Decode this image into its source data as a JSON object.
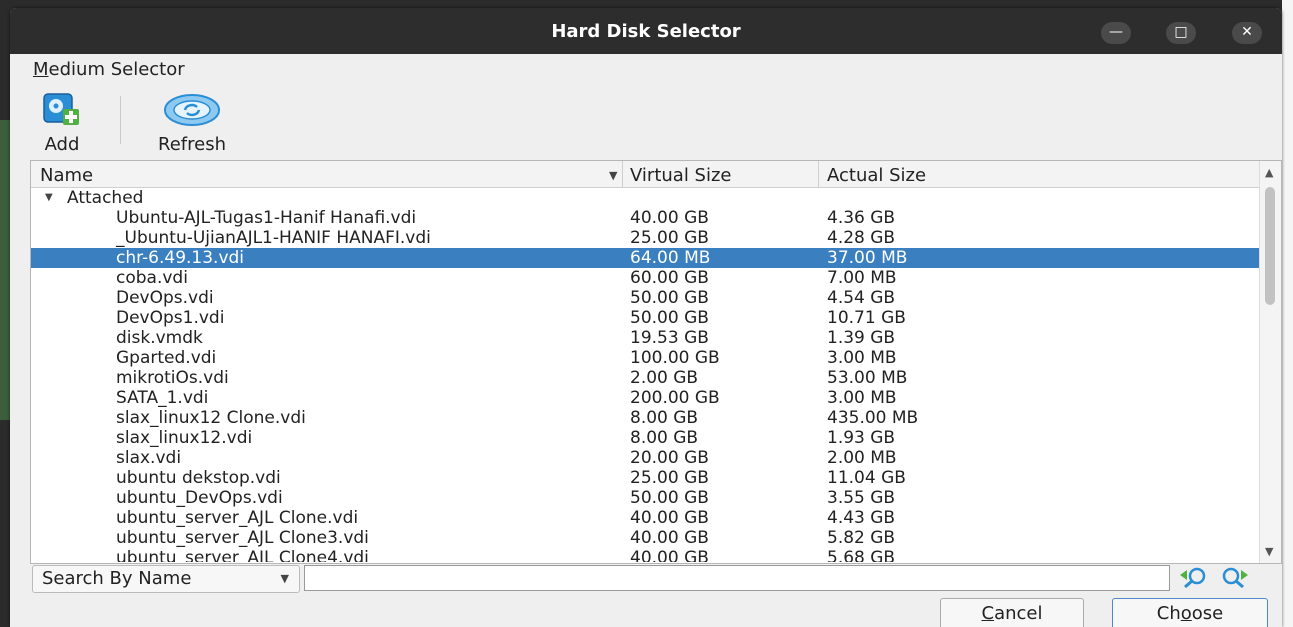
{
  "window": {
    "title": "Hard Disk Selector",
    "controls": {
      "minimize": "—",
      "maximize": "□",
      "close": "✕"
    }
  },
  "menu": {
    "medium_selector_first": "M",
    "medium_selector_rest": "edium Selector"
  },
  "toolbar": {
    "add_label": "Add",
    "refresh_label": "Refresh"
  },
  "table": {
    "columns": [
      "Name",
      "Virtual Size",
      "Actual Size"
    ],
    "group_label": "Attached",
    "rows": [
      {
        "name": "Ubuntu-AJL-Tugas1-Hanif Hanafi.vdi",
        "virtual": "40.00 GB",
        "actual": "4.36 GB",
        "selected": false
      },
      {
        "name": "_Ubuntu-UjianAJL1-HANIF HANAFI.vdi",
        "virtual": "25.00 GB",
        "actual": "4.28 GB",
        "selected": false
      },
      {
        "name": "chr-6.49.13.vdi",
        "virtual": "64.00 MB",
        "actual": "37.00 MB",
        "selected": true
      },
      {
        "name": "coba.vdi",
        "virtual": "60.00 GB",
        "actual": "7.00 MB",
        "selected": false
      },
      {
        "name": "DevOps.vdi",
        "virtual": "50.00 GB",
        "actual": "4.54 GB",
        "selected": false
      },
      {
        "name": "DevOps1.vdi",
        "virtual": "50.00 GB",
        "actual": "10.71 GB",
        "selected": false
      },
      {
        "name": "disk.vmdk",
        "virtual": "19.53 GB",
        "actual": "1.39 GB",
        "selected": false
      },
      {
        "name": "Gparted.vdi",
        "virtual": "100.00 GB",
        "actual": "3.00 MB",
        "selected": false
      },
      {
        "name": "mikrotiOs.vdi",
        "virtual": "2.00 GB",
        "actual": "53.00 MB",
        "selected": false
      },
      {
        "name": "SATA_1.vdi",
        "virtual": "200.00 GB",
        "actual": "3.00 MB",
        "selected": false
      },
      {
        "name": "slax_linux12 Clone.vdi",
        "virtual": "8.00 GB",
        "actual": "435.00 MB",
        "selected": false
      },
      {
        "name": "slax_linux12.vdi",
        "virtual": "8.00 GB",
        "actual": "1.93 GB",
        "selected": false
      },
      {
        "name": "slax.vdi",
        "virtual": "20.00 GB",
        "actual": "2.00 MB",
        "selected": false
      },
      {
        "name": "ubuntu dekstop.vdi",
        "virtual": "25.00 GB",
        "actual": "11.04 GB",
        "selected": false
      },
      {
        "name": "ubuntu_DevOps.vdi",
        "virtual": "50.00 GB",
        "actual": "3.55 GB",
        "selected": false
      },
      {
        "name": "ubuntu_server_AJL Clone.vdi",
        "virtual": "40.00 GB",
        "actual": "4.43 GB",
        "selected": false
      },
      {
        "name": "ubuntu_server_AJL Clone3.vdi",
        "virtual": "40.00 GB",
        "actual": "5.82 GB",
        "selected": false
      },
      {
        "name": "ubuntu_server_AJL Clone4.vdi",
        "virtual": "40.00 GB",
        "actual": "5.68 GB",
        "selected": false
      }
    ]
  },
  "search": {
    "mode": "Search By Name",
    "value": ""
  },
  "buttons": {
    "cancel_first": "C",
    "cancel_rest": "ancel",
    "choose_first": "Ch",
    "choose_under": "o",
    "choose_rest": "ose"
  },
  "colors": {
    "selection": "#3a7fbf",
    "titlebar": "#2d2d2d",
    "icon_blue": "#2a8ed6",
    "icon_green": "#52b043"
  }
}
